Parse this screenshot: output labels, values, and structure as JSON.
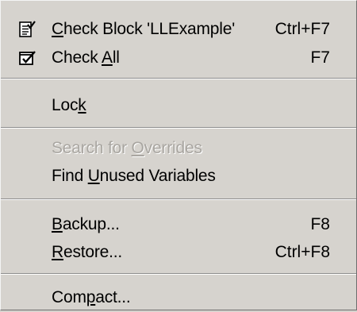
{
  "menu": {
    "items": [
      {
        "id": "check-block",
        "prefix": "",
        "accel": "C",
        "suffix": "heck Block 'LLExample'",
        "shortcut": "Ctrl+F7",
        "icon": "check-document-icon",
        "disabled": false
      },
      {
        "id": "check-all",
        "prefix": "Check ",
        "accel": "A",
        "suffix": "ll",
        "shortcut": "F7",
        "icon": "check-box-icon",
        "disabled": false
      },
      {
        "id": "lock",
        "prefix": "Loc",
        "accel": "k",
        "suffix": "",
        "shortcut": "",
        "icon": "",
        "disabled": false
      },
      {
        "id": "search-overrides",
        "prefix": "Search for ",
        "accel": "O",
        "suffix": "verrides",
        "shortcut": "",
        "icon": "",
        "disabled": true
      },
      {
        "id": "find-unused",
        "prefix": "Find ",
        "accel": "U",
        "suffix": "nused Variables",
        "shortcut": "",
        "icon": "",
        "disabled": false
      },
      {
        "id": "backup",
        "prefix": "",
        "accel": "B",
        "suffix": "ackup...",
        "shortcut": "F8",
        "icon": "",
        "disabled": false
      },
      {
        "id": "restore",
        "prefix": "",
        "accel": "R",
        "suffix": "estore...",
        "shortcut": "Ctrl+F8",
        "icon": "",
        "disabled": false
      },
      {
        "id": "compact",
        "prefix": "Com",
        "accel": "p",
        "suffix": "act...",
        "shortcut": "",
        "icon": "",
        "disabled": false
      }
    ]
  }
}
